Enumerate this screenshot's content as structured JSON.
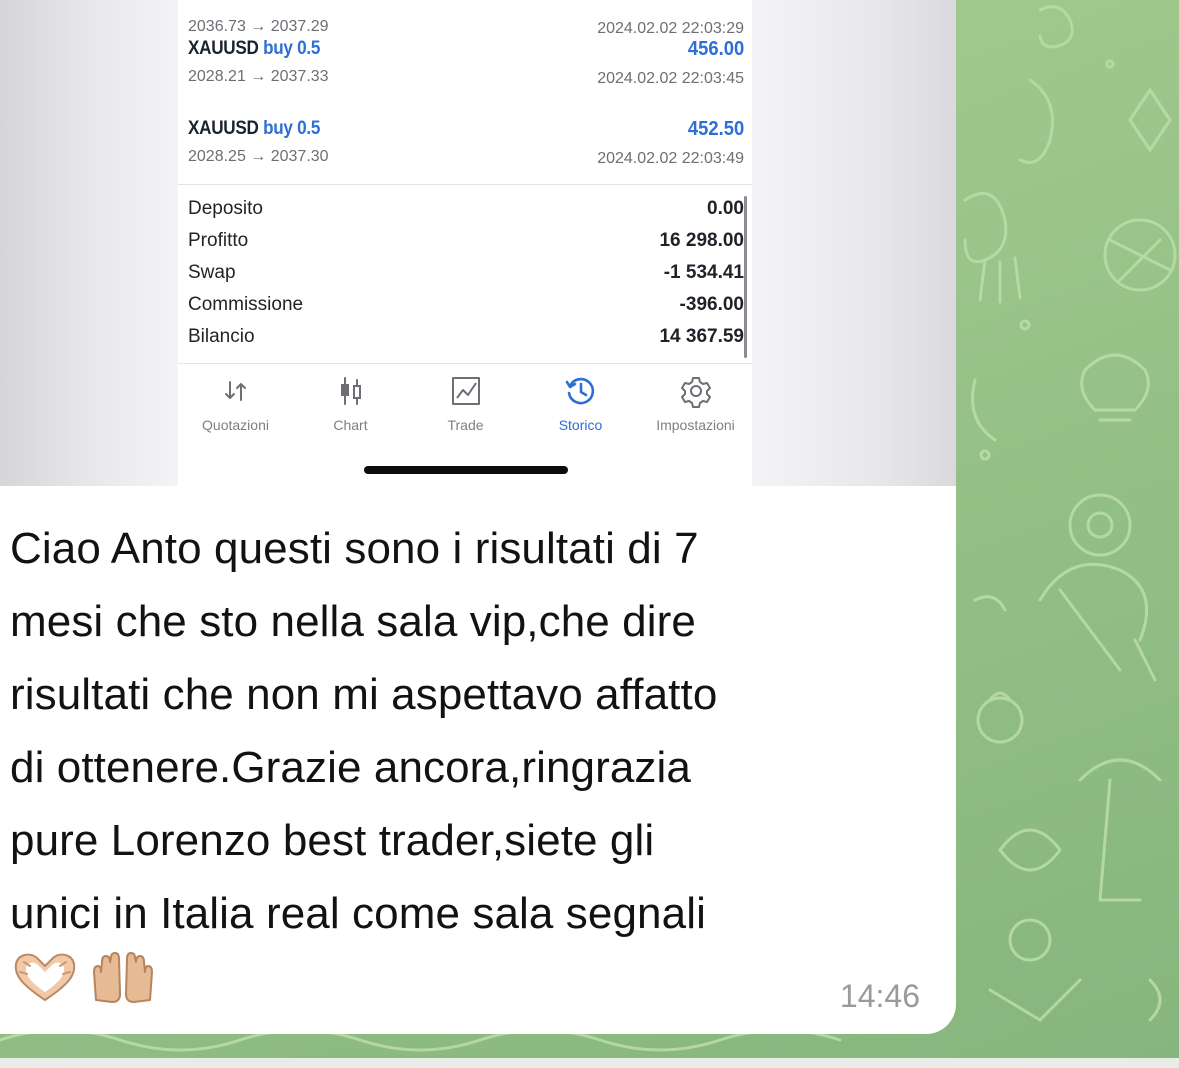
{
  "trades": [
    {
      "symbol": "",
      "side": "",
      "volume": "",
      "price_range": "2036.73 → 2037.29",
      "profit": "",
      "time": "2024.02.02 22:03:29"
    },
    {
      "symbol": "XAUUSD",
      "side": "buy",
      "volume": "0.5",
      "price_range": "2028.21 → 2037.33",
      "profit": "456.00",
      "time": "2024.02.02 22:03:45"
    },
    {
      "symbol": "XAUUSD",
      "side": "buy",
      "volume": "0.5",
      "price_range": "2028.25 → 2037.30",
      "profit": "452.50",
      "time": "2024.02.02 22:03:49"
    }
  ],
  "summary": [
    {
      "label": "Deposito",
      "value": "0.00"
    },
    {
      "label": "Profitto",
      "value": "16 298.00"
    },
    {
      "label": "Swap",
      "value": "-1 534.41"
    },
    {
      "label": "Commissione",
      "value": "-396.00"
    },
    {
      "label": "Bilancio",
      "value": "14 367.59"
    }
  ],
  "tabs": [
    {
      "label": "Quotazioni",
      "icon": "quotes-arrows-icon",
      "active": false
    },
    {
      "label": "Chart",
      "icon": "candlestick-chart-icon",
      "active": false
    },
    {
      "label": "Trade",
      "icon": "trade-chart-icon",
      "active": false
    },
    {
      "label": "Storico",
      "icon": "history-clock-icon",
      "active": true
    },
    {
      "label": "Impostazioni",
      "icon": "settings-gear-icon",
      "active": false
    }
  ],
  "message": {
    "lines": [
      "Ciao Anto questi sono i risultati di 7",
      "mesi che sto nella sala vip,che dire",
      "risultati che non mi aspettavo affatto",
      "di ottenere.Grazie ancora,ringrazia",
      "pure Lorenzo best trader,siete gli",
      "unici in Italia real come sala segnali"
    ],
    "emojis": [
      "heart-hands-emoji",
      "palms-up-emoji"
    ],
    "time": "14:46"
  },
  "colors": {
    "accent": "#2d6fd6",
    "wallpaper": "#9cc48a",
    "bubble": "#ffffff"
  }
}
